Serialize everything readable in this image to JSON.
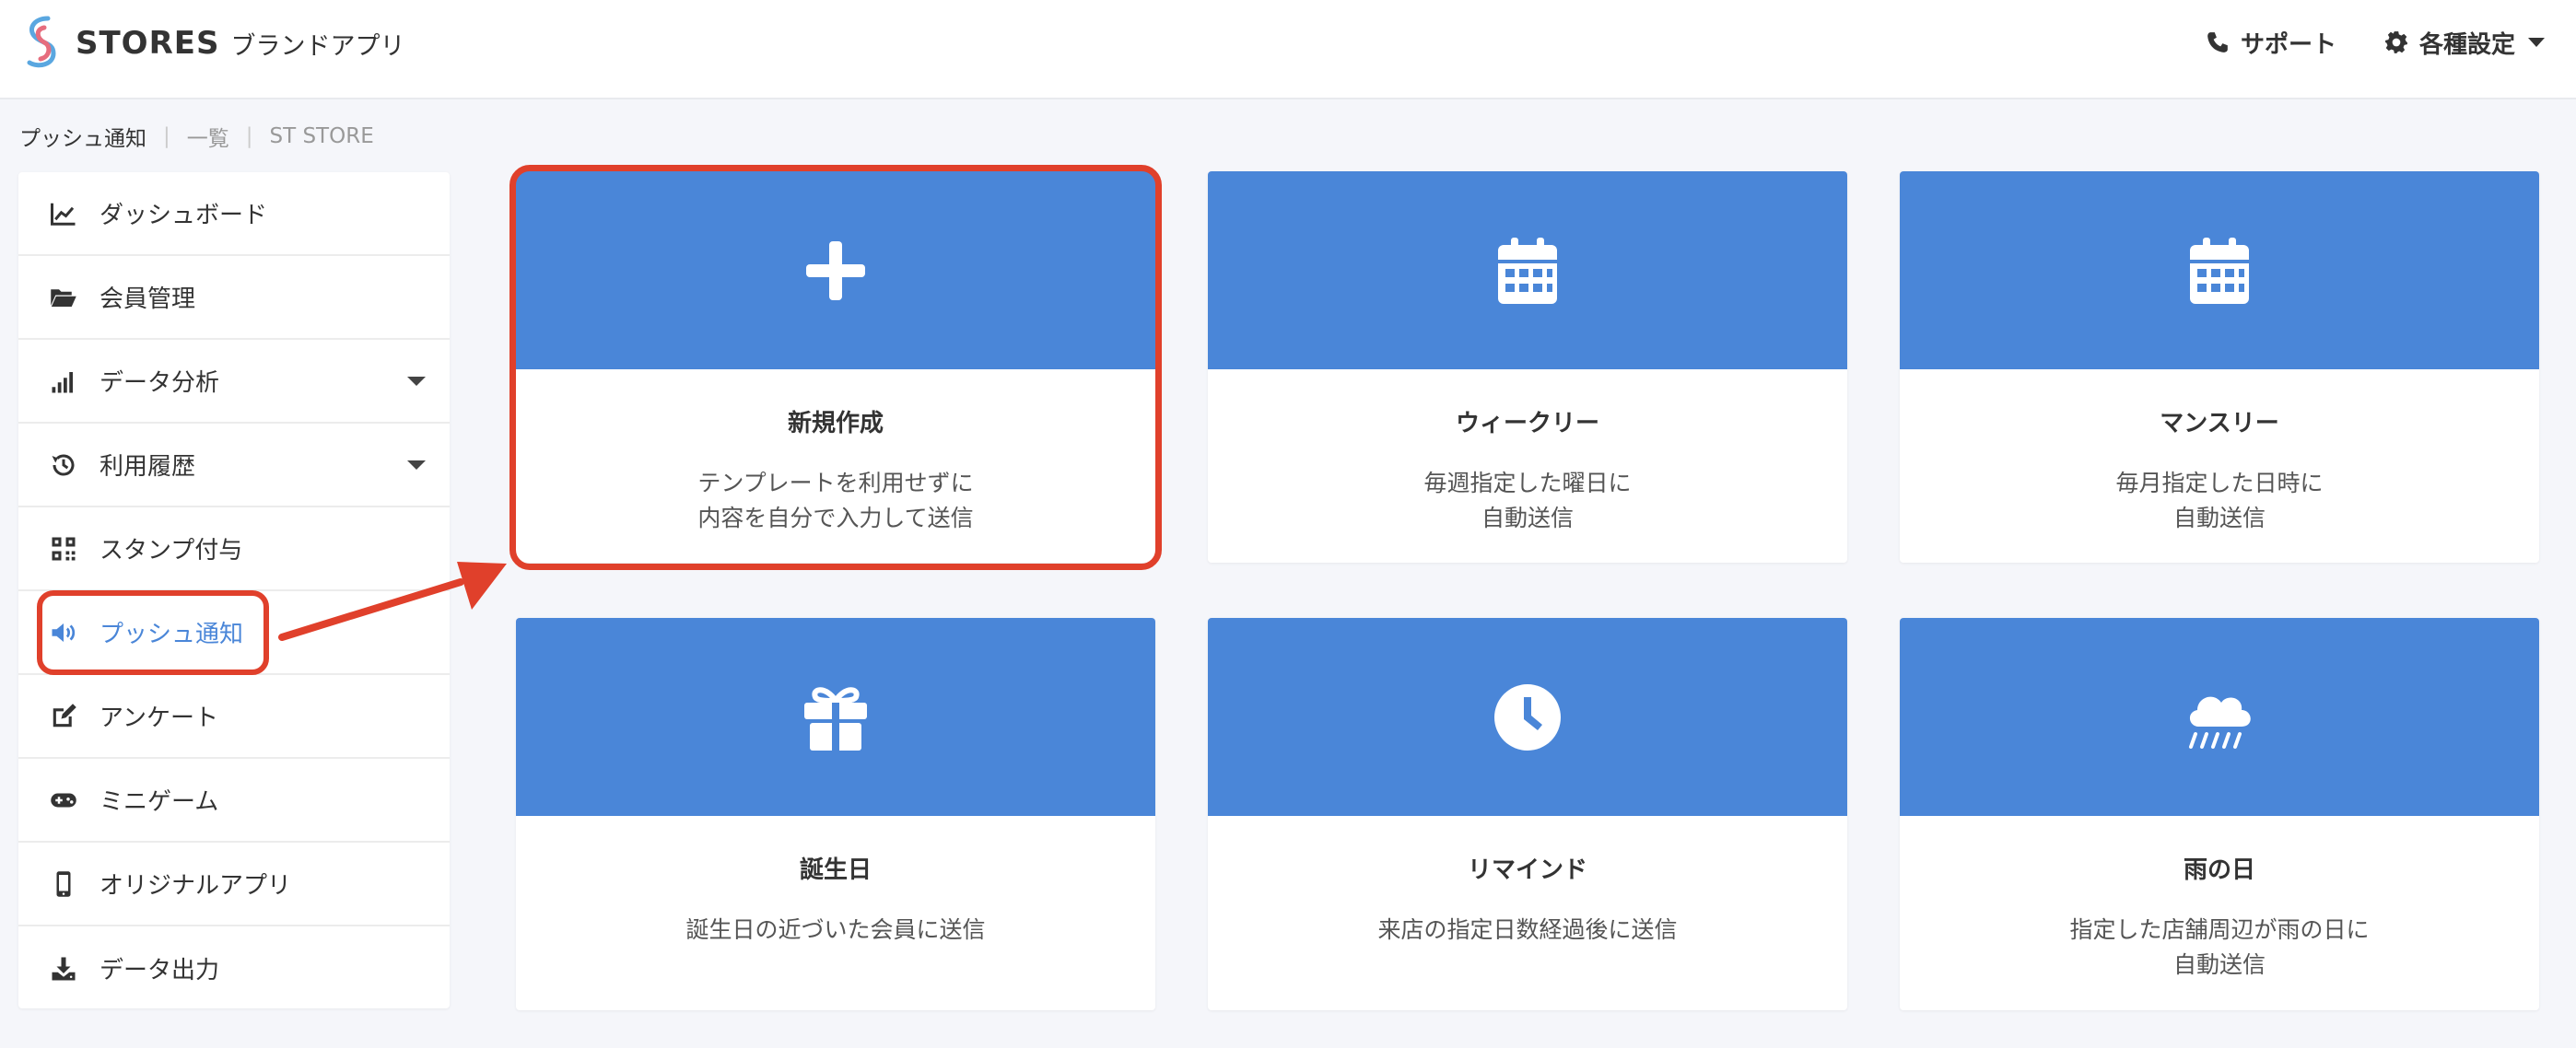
{
  "header": {
    "logo_word": "STORES",
    "logo_sub": "ブランドアプリ",
    "support_label": "サポート",
    "settings_label": "各種設定"
  },
  "breadcrumb": [
    "プッシュ通知",
    "一覧",
    "ST STORE"
  ],
  "sidebar": {
    "items": [
      {
        "label": "ダッシュボード",
        "icon": "chart-line-icon"
      },
      {
        "label": "会員管理",
        "icon": "folder-open-icon"
      },
      {
        "label": "データ分析",
        "icon": "signal-bars-icon",
        "has_dropdown": true
      },
      {
        "label": "利用履歴",
        "icon": "history-icon",
        "has_dropdown": true
      },
      {
        "label": "スタンプ付与",
        "icon": "qrcode-icon"
      },
      {
        "label": "プッシュ通知",
        "icon": "megaphone-icon",
        "active": true
      },
      {
        "label": "アンケート",
        "icon": "edit-icon"
      },
      {
        "label": "ミニゲーム",
        "icon": "gamepad-icon"
      },
      {
        "label": "オリジナルアプリ",
        "icon": "mobile-icon"
      },
      {
        "label": "データ出力",
        "icon": "download-icon"
      }
    ]
  },
  "cards": [
    {
      "title": "新規作成",
      "desc": [
        "テンプレートを利用せずに",
        "内容を自分で入力して送信"
      ],
      "icon": "plus-icon"
    },
    {
      "title": "ウィークリー",
      "desc": [
        "毎週指定した曜日に",
        "自動送信"
      ],
      "icon": "calendar-icon"
    },
    {
      "title": "マンスリー",
      "desc": [
        "毎月指定した日時に",
        "自動送信"
      ],
      "icon": "calendar-icon"
    },
    {
      "title": "誕生日",
      "desc": [
        "誕生日の近づいた会員に送信"
      ],
      "icon": "gift-icon"
    },
    {
      "title": "リマインド",
      "desc": [
        "来店の指定日数経過後に送信"
      ],
      "icon": "clock-icon"
    },
    {
      "title": "雨の日",
      "desc": [
        "指定した店舗周辺が雨の日に",
        "自動送信"
      ],
      "icon": "cloud-rain-icon"
    }
  ],
  "colors": {
    "accent": "#4a86d8",
    "annotation": "#e0402b",
    "background": "#f5f6fa"
  }
}
